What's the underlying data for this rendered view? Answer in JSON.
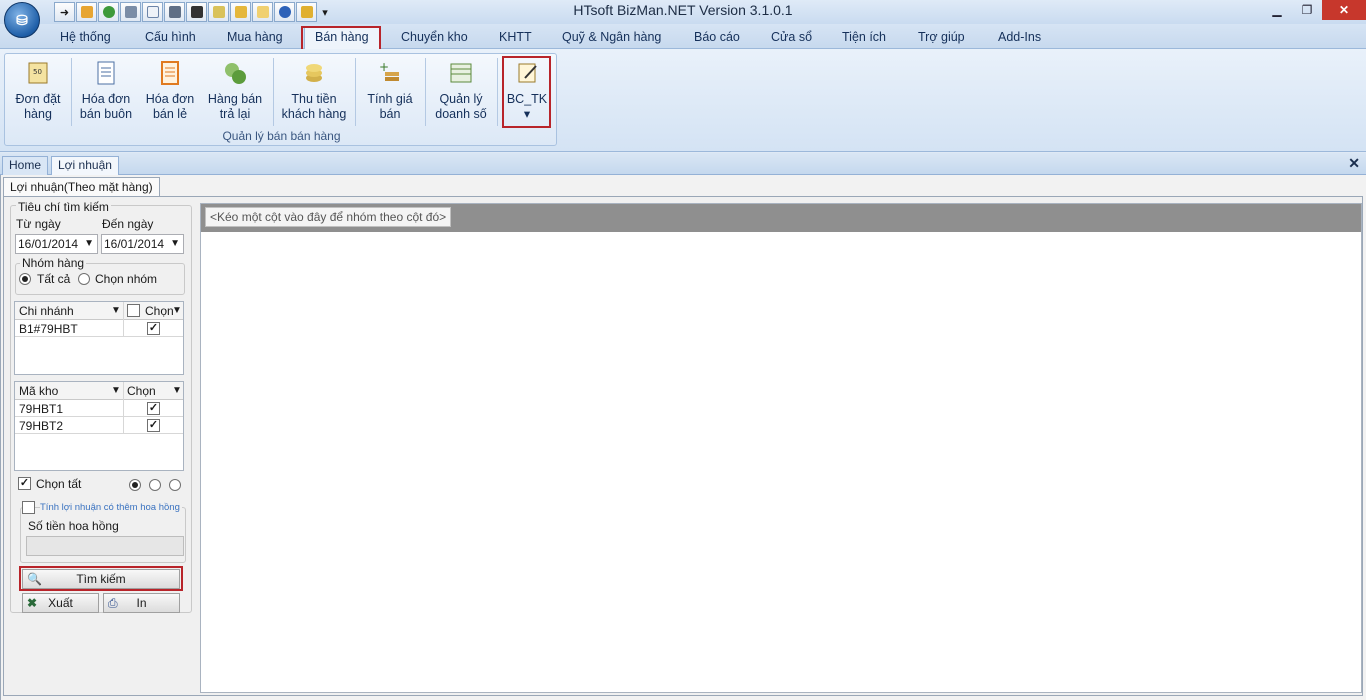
{
  "window": {
    "title": "HTsoft BizMan.NET Version 3.1.0.1",
    "minimize": "▁",
    "restore": "❐",
    "close": "✕"
  },
  "quick_access": [
    "arrow-icon",
    "people-icon",
    "globe-icon",
    "tools-icon",
    "document-icon",
    "print-icon",
    "calculator-icon",
    "edit-icon",
    "folders-icon",
    "mail-icon",
    "help-icon",
    "puzzle-icon",
    "dropdown-icon"
  ],
  "menu": {
    "tabs": [
      "Hệ thống",
      "Cấu hình",
      "Mua hàng",
      "Bán hàng",
      "Chuyển kho",
      "KHTT",
      "Quỹ & Ngân hàng",
      "Báo cáo",
      "Cửa sổ",
      "Tiện ích",
      "Trợ giúp",
      "Add-Ins"
    ],
    "active": "Bán hàng"
  },
  "ribbon": {
    "group_label": "Quản lý bán bán hàng",
    "buttons": [
      {
        "line1": "Đơn đặt",
        "line2": "hàng"
      },
      {
        "line1": "Hóa đơn",
        "line2": "bán buôn"
      },
      {
        "line1": "Hóa đơn",
        "line2": "bán lẻ"
      },
      {
        "line1": "Hàng bán",
        "line2": "trả lại"
      },
      {
        "line1": "Thu tiền",
        "line2": "khách hàng"
      },
      {
        "line1": "Tính giá",
        "line2": "bán"
      },
      {
        "line1": "Quản lý",
        "line2": "doanh số"
      },
      {
        "line1": "BC_TK",
        "line2": "▾"
      }
    ]
  },
  "doc_tabs": [
    "Home",
    "Lợi nhuận"
  ],
  "doc_close": "✕",
  "sub_tab": "Lợi nhuận(Theo mặt hàng)",
  "search": {
    "legend": "Tiêu chí tìm kiếm",
    "from_label": "Từ ngày",
    "to_label": "Đến ngày",
    "from_value": "16/01/2014",
    "to_value": "16/01/2014",
    "group_legend": "Nhóm hàng",
    "radio_all": "Tất cả",
    "radio_select": "Chọn nhóm",
    "branch_grid": {
      "col1": "Chi nhánh",
      "col2": "Chọn",
      "rows": [
        {
          "name": "B1#79HBT",
          "checked": true
        }
      ]
    },
    "warehouse_grid": {
      "col1": "Mã kho",
      "col2": "Chọn",
      "rows": [
        {
          "name": "79HBT1",
          "checked": true
        },
        {
          "name": "79HBT2",
          "checked": true
        }
      ]
    },
    "select_all": "Chọn tất",
    "commission_checkbox": "Tính lợi nhuận có thêm hoa hồng",
    "commission_amount_label": "Số tiền hoa hồng",
    "search_button": "Tìm kiếm",
    "export_button": "Xuất",
    "print_button": "In"
  },
  "grid": {
    "group_hint": "<Kéo một cột vào đây để nhóm theo cột đó>"
  },
  "colors": {
    "highlight": "#b8242a",
    "ribbon_text": "#15305a"
  }
}
